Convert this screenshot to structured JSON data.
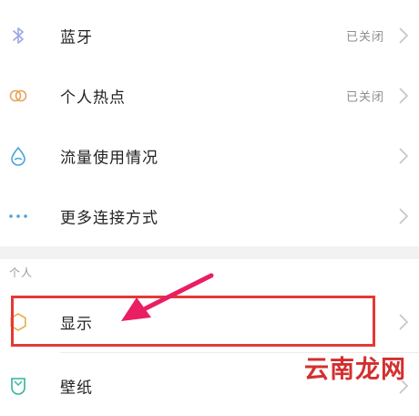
{
  "connectivity": {
    "items": [
      {
        "label": "蓝牙",
        "status": "已关闭",
        "icon": "bluetooth-icon"
      },
      {
        "label": "个人热点",
        "status": "已关闭",
        "icon": "hotspot-icon"
      },
      {
        "label": "流量使用情况",
        "status": "",
        "icon": "data-usage-icon"
      },
      {
        "label": "更多连接方式",
        "status": "",
        "icon": "more-dots-icon"
      }
    ]
  },
  "personal": {
    "header": "个人",
    "items": [
      {
        "label": "显示",
        "icon": "brightness-icon"
      },
      {
        "label": "壁纸",
        "icon": "wallpaper-icon"
      }
    ]
  },
  "annotation": {
    "highlight_color": "#e53935",
    "arrow_color": "#e91e63"
  },
  "watermark": {
    "text": "云南龙网"
  },
  "colors": {
    "bluetooth": "#9aa6e6",
    "hotspot": "#e9a25a",
    "data_usage": "#4aa3d8",
    "more": "#4aa3d8",
    "display": "#e7b04a",
    "wallpaper": "#35b39a"
  }
}
